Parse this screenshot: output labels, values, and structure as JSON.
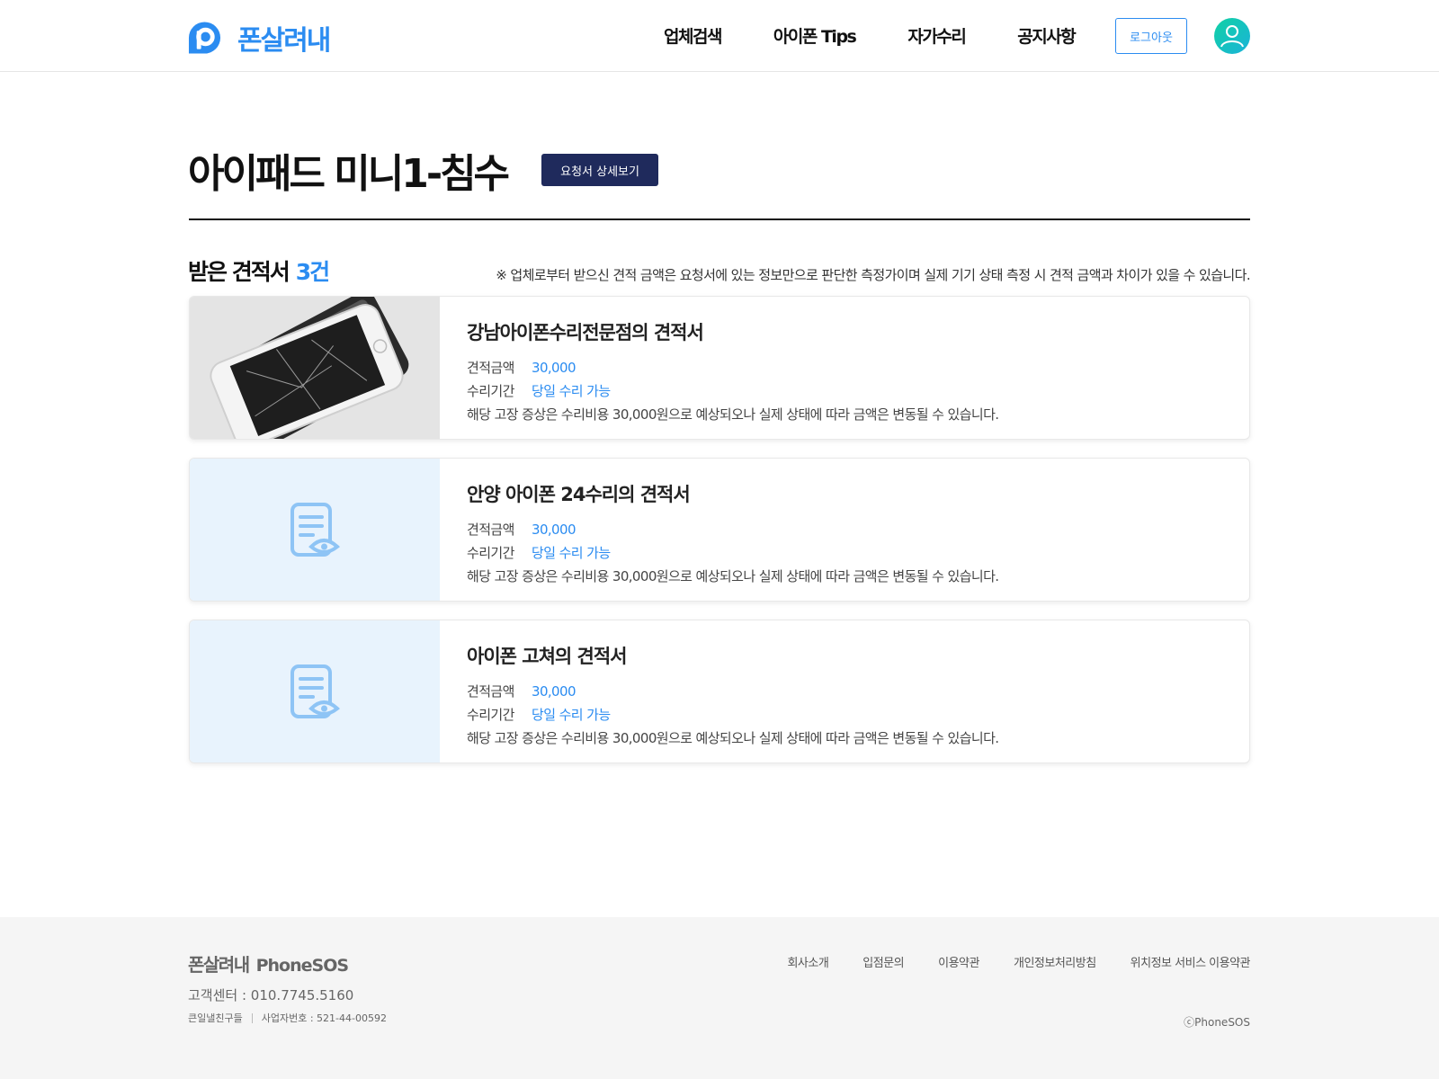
{
  "header": {
    "logo_text": "폰살려내",
    "nav": [
      "업체검색",
      "아이폰 Tips",
      "자가수리",
      "공지사항"
    ],
    "logout_label": "로그아웃",
    "brand_color": "#2b8cf1"
  },
  "main": {
    "title": "아이패드 미니1-침수",
    "detail_button": "요청서 상세보기",
    "count_label": "받은 견적서",
    "count_value": "3건",
    "notice": "※ 업체로부터 받으신 견적 금액은 요청서에 있는 정보만으로 판단한 측정가이며 실제 기기 상태 측정 시 견적 금액과 차이가 있을 수 있습니다.",
    "cards": [
      {
        "title": "강남아이폰수리전문점의 견적서",
        "price_label": "견적금액",
        "price": "30,000",
        "period_label": "수리기간",
        "period": "당일 수리 가능",
        "description": "해당 고장 증상은 수리비용 30,000원으로 예상되오나 실제 상태에 따라 금액은 변동될 수 있습니다.",
        "thumbnail": "broken-iphone-photo"
      },
      {
        "title": "안양 아이폰 24수리의 견적서",
        "price_label": "견적금액",
        "price": "30,000",
        "period_label": "수리기간",
        "period": "당일 수리 가능",
        "description": "해당 고장 증상은 수리비용 30,000원으로 예상되오나 실제 상태에 따라 금액은 변동될 수 있습니다.",
        "thumbnail": "document-view-icon"
      },
      {
        "title": "아이폰 고쳐의 견적서",
        "price_label": "견적금액",
        "price": "30,000",
        "period_label": "수리기간",
        "period": "당일 수리 가능",
        "description": "해당 고장 증상은 수리비용 30,000원으로 예상되오나 실제 상태에 따라 금액은 변동될 수 있습니다.",
        "thumbnail": "document-view-icon"
      }
    ]
  },
  "footer": {
    "logo_kr": "폰살려내",
    "logo_en": "PhoneSOS",
    "cs": "고객센터 : 010.7745.5160",
    "company": "큰일낼친구들",
    "biz_no": "사업자번호 : 521-44-00592",
    "links": [
      "회사소개",
      "입점문의",
      "이용약관",
      "개인정보처리방침",
      "위치정보 서비스 이용약관"
    ],
    "copyright": "ⓒPhoneSOS"
  }
}
